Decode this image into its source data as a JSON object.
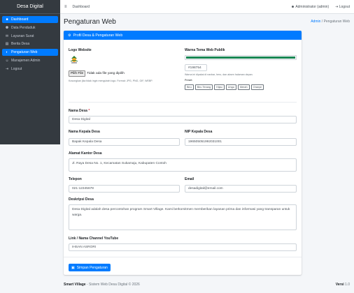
{
  "sidebar": {
    "brand": "Desa Digital",
    "items": [
      {
        "icon": "■",
        "label": "Dashboard"
      },
      {
        "icon": "⚉",
        "label": "Data Penduduk"
      },
      {
        "icon": "✉",
        "label": "Layanan Surat"
      },
      {
        "icon": "▤",
        "label": "Berita Desa"
      },
      {
        "icon": "◐",
        "label": "Pengaturan Web"
      },
      {
        "icon": "☺",
        "label": "Manajemen Admin"
      },
      {
        "icon": "⇥",
        "label": "Logout"
      }
    ]
  },
  "topbar": {
    "menu_icon": "≡",
    "dashboard_link": "Dashboard",
    "user_icon": "☻",
    "user_label": "Administrator (admin)",
    "logout_icon": "⇥",
    "logout_label": "Logout"
  },
  "header": {
    "title": "Pengaturan Web",
    "breadcrumb_home": "Admin",
    "breadcrumb_sep": "/",
    "breadcrumb_current": "Pengaturan Web"
  },
  "card": {
    "header_icon": "⚙",
    "header_title": "Profil Desa & Pengaturan Web",
    "logo_label": "Logo Website",
    "file_button": "Pilih File",
    "file_status": "Tidak ada file yang dipilih",
    "logo_help": "Kosongkan jika tidak ingin mengubah logo. Format: JPG, PNG, GIF, WEBP.",
    "theme_label": "Warna Tema Web Publik",
    "theme_color": "#198754",
    "theme_value": "#198754",
    "theme_help": "Warna ini dipakai di navbar, hero, dan aksen halaman depan.",
    "preset_label": "Preset:",
    "presets": [
      "Biru",
      "Biru Terang",
      "Hijau",
      "Ungu",
      "Merah",
      "Oranye"
    ],
    "nama_desa_label": "Nama Desa",
    "required_mark": "*",
    "nama_desa_value": "Desa Digital",
    "kepala_label": "Nama Kepala Desa",
    "kepala_value": "Bapak Kepala Desa",
    "nip_label": "NIP Kepala Desa",
    "nip_value": "196505051992031001",
    "alamat_label": "Alamat Kantor Desa",
    "alamat_value": "Jl. Raya Desa No. 1, Kecamatan Sukamaju, Kabupaten Contoh",
    "telepon_label": "Telepon",
    "telepon_value": "021-12345678",
    "email_label": "Email",
    "email_value": "desadigital@email.com",
    "deskripsi_label": "Deskripsi Desa",
    "deskripsi_value": "Desa Digital adalah desa percontohan program Smart Village. Kami berkomitmen memberikan layanan prima dan informasi yang transparan untuk warga.",
    "youtube_label": "Link / Nama Channel YouTube",
    "youtube_value": "IHSAN ASRORI",
    "save_icon": "▣",
    "save_label": "Simpan Pengaturan"
  },
  "footer": {
    "brand": "Smart Village",
    "text": " - Sistem Web Desa Digital © 2026",
    "version_label": "Versi",
    "version": "1.0"
  }
}
